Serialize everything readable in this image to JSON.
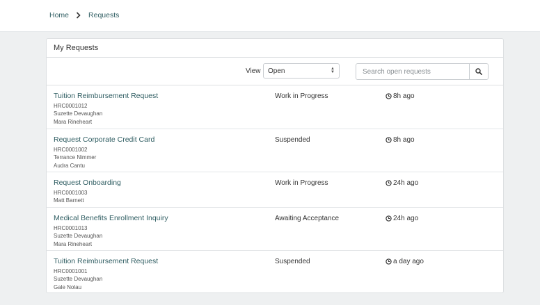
{
  "breadcrumb": {
    "home": "Home",
    "current": "Requests"
  },
  "panel": {
    "title": "My Requests"
  },
  "toolbar": {
    "view_label": "View",
    "view_selected": "Open",
    "search_placeholder": "Search open requests"
  },
  "requests": [
    {
      "title": "Tuition Reimbursement Request",
      "number": "HRC0001012",
      "people": [
        "Suzette Devaughan",
        "Mara Rineheart"
      ],
      "status": "Work in Progress",
      "updated": "8h ago"
    },
    {
      "title": "Request Corporate Credit Card",
      "number": "HRC0001002",
      "people": [
        "Terrance Nimmer",
        "Audra Cantu"
      ],
      "status": "Suspended",
      "updated": "8h ago"
    },
    {
      "title": "Request Onboarding",
      "number": "HRC0001003",
      "people": [
        "Matt Barnett"
      ],
      "status": "Work in Progress",
      "updated": "24h ago"
    },
    {
      "title": "Medical Benefits Enrollment Inquiry",
      "number": "HRC0001013",
      "people": [
        "Suzette Devaughan",
        "Mara Rineheart"
      ],
      "status": "Awaiting Acceptance",
      "updated": "24h ago"
    },
    {
      "title": "Tuition Reimbursement Request",
      "number": "HRC0001001",
      "people": [
        "Suzette Devaughan",
        "Gale Nolau"
      ],
      "status": "Suspended",
      "updated": "a day ago"
    }
  ],
  "icons": {
    "breadcrumb_separator": "chevron-right-icon",
    "search": "search-icon",
    "time": "clock-icon",
    "select": "select-arrows-icon"
  },
  "colors": {
    "link": "#2f5d62",
    "page_background": "#eef0f1",
    "panel_background": "#ffffff",
    "border": "#dcdfe1"
  }
}
